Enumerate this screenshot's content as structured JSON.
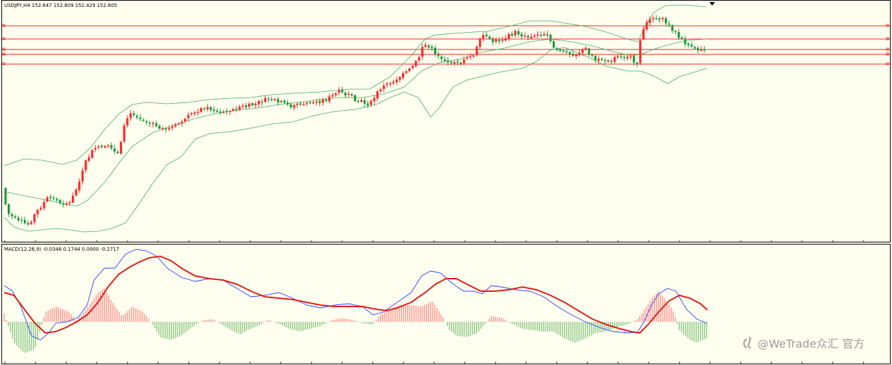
{
  "price_header": "USDJPY,H4  152.647 152.809 152.429 152.605",
  "macd_header": "MACD(12,26,9) -0.0346 0.1744 0.0000 -0.2717",
  "watermark": "@WeTrade众汇 官方",
  "watermark_icon": "stylized-s-logo-icon",
  "colors": {
    "background": "#fffff0",
    "bull_candle": "#ff2a2a",
    "bear_candle": "#1e9a3a",
    "bollinger": "#3caf5a",
    "hline": "#ff2020",
    "macd_line": "#2c3cff",
    "signal_line": "#e41b17",
    "hist_positive": "#ff3b3b",
    "hist_negative": "#2e9a2e"
  },
  "chart_data": [
    {
      "type": "candlestick",
      "title": "USDJPY,H4",
      "symbol": "USDJPY",
      "timeframe": "H4",
      "last_bar": {
        "open": 152.647,
        "high": 152.809,
        "low": 152.429,
        "close": 152.605
      },
      "indicators": [
        "Bollinger Bands"
      ],
      "note": "Price trends from lower-left up to a peak near the right, then pulls back; five horizontal red lines mark levels near the top."
    },
    {
      "type": "macd",
      "title": "MACD(12,26,9)",
      "values": {
        "main": -0.0346,
        "signal": 0.1744,
        "v3": 0.0,
        "v4": -0.2717
      },
      "series": [
        {
          "name": "MACD",
          "color": "#2c3cff"
        },
        {
          "name": "Signal",
          "color": "#e41b17"
        }
      ]
    }
  ]
}
